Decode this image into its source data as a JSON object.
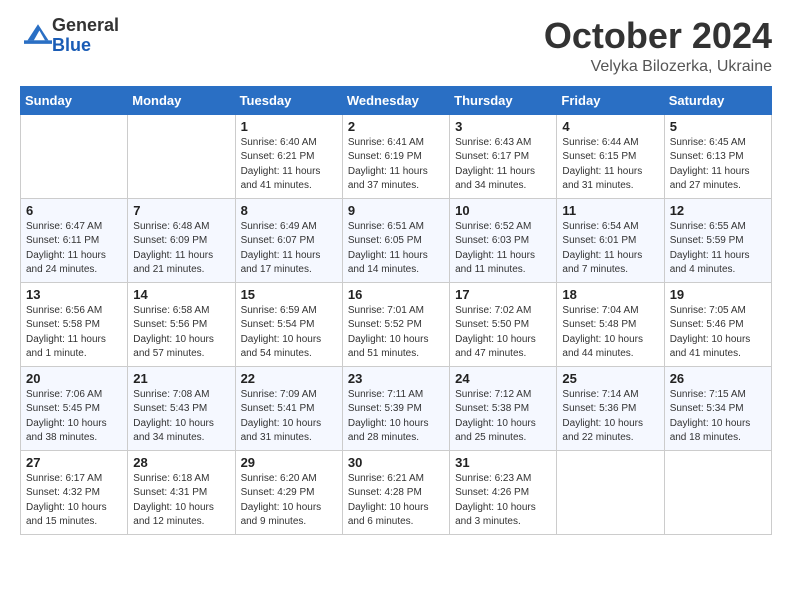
{
  "header": {
    "logo_general": "General",
    "logo_blue": "Blue",
    "title": "October 2024",
    "location": "Velyka Bilozerka, Ukraine"
  },
  "weekdays": [
    "Sunday",
    "Monday",
    "Tuesday",
    "Wednesday",
    "Thursday",
    "Friday",
    "Saturday"
  ],
  "weeks": [
    [
      {
        "day": "",
        "detail": ""
      },
      {
        "day": "",
        "detail": ""
      },
      {
        "day": "1",
        "detail": "Sunrise: 6:40 AM\nSunset: 6:21 PM\nDaylight: 11 hours\nand 41 minutes."
      },
      {
        "day": "2",
        "detail": "Sunrise: 6:41 AM\nSunset: 6:19 PM\nDaylight: 11 hours\nand 37 minutes."
      },
      {
        "day": "3",
        "detail": "Sunrise: 6:43 AM\nSunset: 6:17 PM\nDaylight: 11 hours\nand 34 minutes."
      },
      {
        "day": "4",
        "detail": "Sunrise: 6:44 AM\nSunset: 6:15 PM\nDaylight: 11 hours\nand 31 minutes."
      },
      {
        "day": "5",
        "detail": "Sunrise: 6:45 AM\nSunset: 6:13 PM\nDaylight: 11 hours\nand 27 minutes."
      }
    ],
    [
      {
        "day": "6",
        "detail": "Sunrise: 6:47 AM\nSunset: 6:11 PM\nDaylight: 11 hours\nand 24 minutes."
      },
      {
        "day": "7",
        "detail": "Sunrise: 6:48 AM\nSunset: 6:09 PM\nDaylight: 11 hours\nand 21 minutes."
      },
      {
        "day": "8",
        "detail": "Sunrise: 6:49 AM\nSunset: 6:07 PM\nDaylight: 11 hours\nand 17 minutes."
      },
      {
        "day": "9",
        "detail": "Sunrise: 6:51 AM\nSunset: 6:05 PM\nDaylight: 11 hours\nand 14 minutes."
      },
      {
        "day": "10",
        "detail": "Sunrise: 6:52 AM\nSunset: 6:03 PM\nDaylight: 11 hours\nand 11 minutes."
      },
      {
        "day": "11",
        "detail": "Sunrise: 6:54 AM\nSunset: 6:01 PM\nDaylight: 11 hours\nand 7 minutes."
      },
      {
        "day": "12",
        "detail": "Sunrise: 6:55 AM\nSunset: 5:59 PM\nDaylight: 11 hours\nand 4 minutes."
      }
    ],
    [
      {
        "day": "13",
        "detail": "Sunrise: 6:56 AM\nSunset: 5:58 PM\nDaylight: 11 hours\nand 1 minute."
      },
      {
        "day": "14",
        "detail": "Sunrise: 6:58 AM\nSunset: 5:56 PM\nDaylight: 10 hours\nand 57 minutes."
      },
      {
        "day": "15",
        "detail": "Sunrise: 6:59 AM\nSunset: 5:54 PM\nDaylight: 10 hours\nand 54 minutes."
      },
      {
        "day": "16",
        "detail": "Sunrise: 7:01 AM\nSunset: 5:52 PM\nDaylight: 10 hours\nand 51 minutes."
      },
      {
        "day": "17",
        "detail": "Sunrise: 7:02 AM\nSunset: 5:50 PM\nDaylight: 10 hours\nand 47 minutes."
      },
      {
        "day": "18",
        "detail": "Sunrise: 7:04 AM\nSunset: 5:48 PM\nDaylight: 10 hours\nand 44 minutes."
      },
      {
        "day": "19",
        "detail": "Sunrise: 7:05 AM\nSunset: 5:46 PM\nDaylight: 10 hours\nand 41 minutes."
      }
    ],
    [
      {
        "day": "20",
        "detail": "Sunrise: 7:06 AM\nSunset: 5:45 PM\nDaylight: 10 hours\nand 38 minutes."
      },
      {
        "day": "21",
        "detail": "Sunrise: 7:08 AM\nSunset: 5:43 PM\nDaylight: 10 hours\nand 34 minutes."
      },
      {
        "day": "22",
        "detail": "Sunrise: 7:09 AM\nSunset: 5:41 PM\nDaylight: 10 hours\nand 31 minutes."
      },
      {
        "day": "23",
        "detail": "Sunrise: 7:11 AM\nSunset: 5:39 PM\nDaylight: 10 hours\nand 28 minutes."
      },
      {
        "day": "24",
        "detail": "Sunrise: 7:12 AM\nSunset: 5:38 PM\nDaylight: 10 hours\nand 25 minutes."
      },
      {
        "day": "25",
        "detail": "Sunrise: 7:14 AM\nSunset: 5:36 PM\nDaylight: 10 hours\nand 22 minutes."
      },
      {
        "day": "26",
        "detail": "Sunrise: 7:15 AM\nSunset: 5:34 PM\nDaylight: 10 hours\nand 18 minutes."
      }
    ],
    [
      {
        "day": "27",
        "detail": "Sunrise: 6:17 AM\nSunset: 4:32 PM\nDaylight: 10 hours\nand 15 minutes."
      },
      {
        "day": "28",
        "detail": "Sunrise: 6:18 AM\nSunset: 4:31 PM\nDaylight: 10 hours\nand 12 minutes."
      },
      {
        "day": "29",
        "detail": "Sunrise: 6:20 AM\nSunset: 4:29 PM\nDaylight: 10 hours\nand 9 minutes."
      },
      {
        "day": "30",
        "detail": "Sunrise: 6:21 AM\nSunset: 4:28 PM\nDaylight: 10 hours\nand 6 minutes."
      },
      {
        "day": "31",
        "detail": "Sunrise: 6:23 AM\nSunset: 4:26 PM\nDaylight: 10 hours\nand 3 minutes."
      },
      {
        "day": "",
        "detail": ""
      },
      {
        "day": "",
        "detail": ""
      }
    ]
  ]
}
